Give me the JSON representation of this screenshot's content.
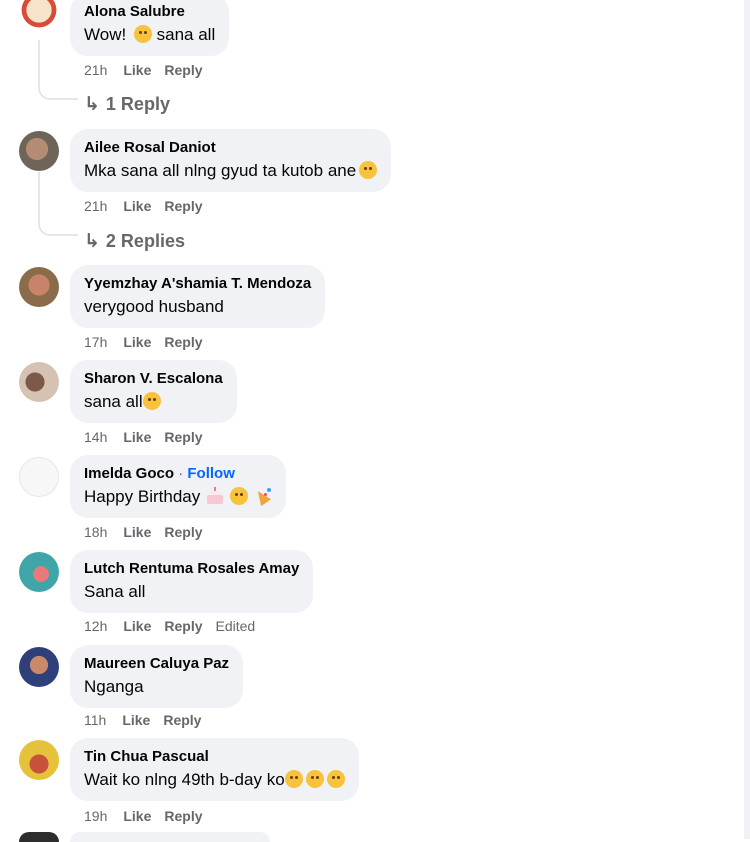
{
  "comments": [
    {
      "author": "Alona Salubre",
      "text": "Wow! ",
      "text_after": " sana all",
      "time": "21h",
      "like": "Like",
      "reply": "Reply",
      "replies_label": "1 Reply",
      "avatar_colors": [
        "#f6e3c8",
        "#d84b38"
      ]
    },
    {
      "author": "Ailee Rosal Daniot",
      "text": "Mka sana all nlng gyud ta kutob ane",
      "time": "21h",
      "like": "Like",
      "reply": "Reply",
      "replies_label": "2 Replies",
      "avatar_colors": [
        "#6f6458",
        "#b48b73"
      ]
    },
    {
      "author": "Yyemzhay A'shamia T. Mendoza",
      "text": "verygood husband",
      "time": "17h",
      "like": "Like",
      "reply": "Reply",
      "avatar_colors": [
        "#8a6b4a",
        "#c9836a"
      ]
    },
    {
      "author": "Sharon V. Escalona",
      "text": "sana all",
      "time": "14h",
      "like": "Like",
      "reply": "Reply",
      "avatar_colors": [
        "#d6c2b2",
        "#7c5a4a"
      ]
    },
    {
      "author": "Imelda Goco",
      "follow_sep": " · ",
      "follow": "Follow",
      "text": "Happy Birthday",
      "time": "18h",
      "like": "Like",
      "reply": "Reply",
      "avatar_colors": [
        "#f3f3f3",
        "#d9c9c9"
      ]
    },
    {
      "author": "Lutch Rentuma Rosales Amay",
      "text": "Sana all",
      "time": "12h",
      "like": "Like",
      "reply": "Reply",
      "edited": "Edited",
      "avatar_colors": [
        "#3fa5a8",
        "#e77a7a"
      ]
    },
    {
      "author": "Maureen Caluya Paz",
      "text": "Nganga",
      "time": "11h",
      "like": "Like",
      "reply": "Reply",
      "avatar_colors": [
        "#2f3f7a",
        "#c98a6a"
      ]
    },
    {
      "author": "Tin Chua Pascual",
      "text": "Wait ko nlng 49th b-day ko",
      "time": "19h",
      "like": "Like",
      "reply": "Reply",
      "avatar_colors": [
        "#e6c23a",
        "#c8513a"
      ]
    }
  ]
}
